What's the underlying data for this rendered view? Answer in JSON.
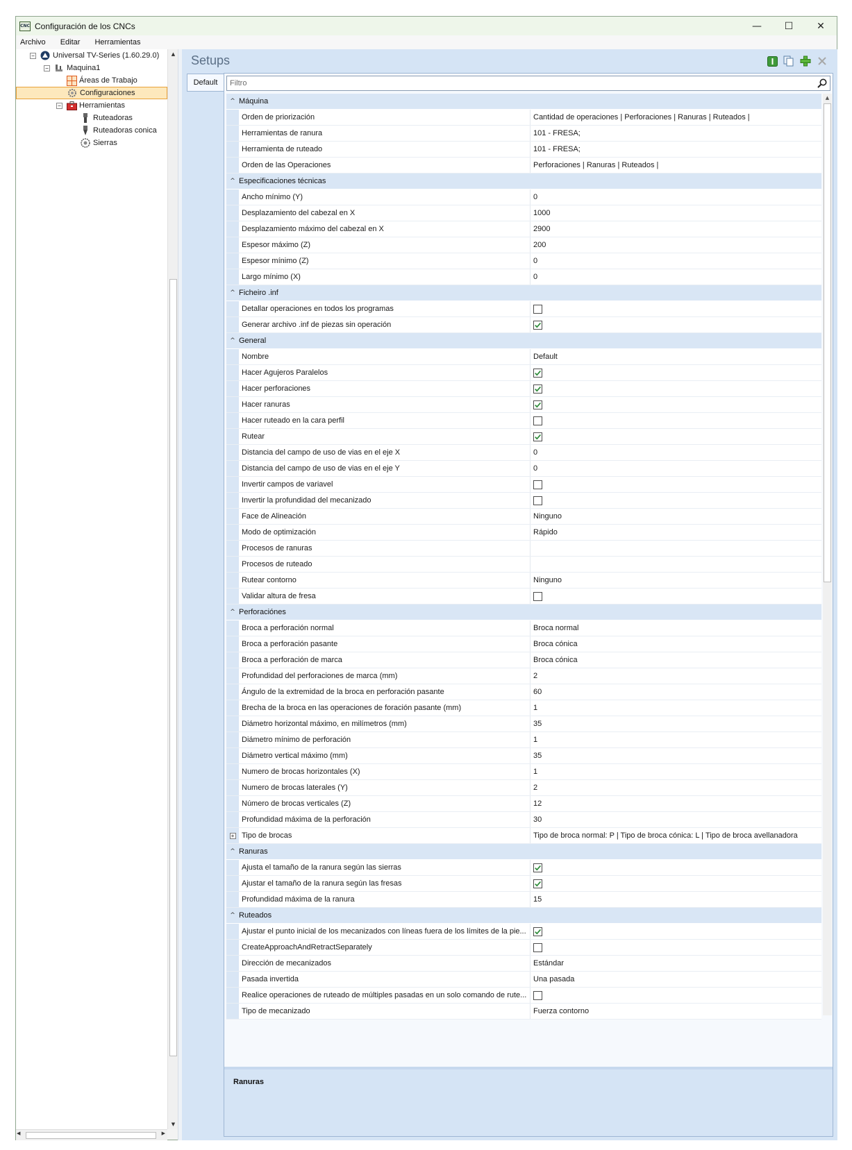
{
  "window": {
    "app_icon_text": "CNC",
    "title": "Configuración de los CNCs",
    "controls": {
      "minimize": "—",
      "maximize": "☐",
      "close": "✕"
    }
  },
  "menu": [
    "Archivo",
    "Editar",
    "Herramientas"
  ],
  "tree": {
    "root": "Universal TV-Series (1.60.29.0)",
    "machine": "Maquina1",
    "work_areas": "Áreas de Trabajo",
    "configs": "Configuraciones",
    "tools": "Herramientas",
    "routers": "Ruteadoras",
    "conic_routers": "Ruteadoras conica",
    "saws": "Sierras"
  },
  "panel": {
    "title": "Setups",
    "tab": "Default",
    "filter_placeholder": "Filtro",
    "description_title": "Ranuras"
  },
  "colors": {
    "accent": "#5b6f86",
    "category_bg": "#d9e6f5",
    "selected_bg": "#fde8bc",
    "check_green": "#2e8b3a"
  },
  "grid": {
    "categories": [
      {
        "label": "Máquina",
        "rows": [
          {
            "name": "Orden de priorización",
            "value": "Cantidad de operaciones | Perforaciones | Ranuras | Ruteados |"
          },
          {
            "name": "Herramientas de ranura",
            "value": "101 - FRESA;"
          },
          {
            "name": "Herramienta de ruteado",
            "value": "101 - FRESA;"
          },
          {
            "name": "Orden de las Operaciones",
            "value": "Perforaciones | Ranuras | Ruteados |"
          }
        ]
      },
      {
        "label": "Especificaciones técnicas",
        "rows": [
          {
            "name": "Ancho mínimo (Y)",
            "value": "0"
          },
          {
            "name": "Desplazamiento del cabezal en X",
            "value": "1000"
          },
          {
            "name": "Desplazamiento máximo del cabezal en X",
            "value": "2900"
          },
          {
            "name": "Espesor máximo (Z)",
            "value": "200"
          },
          {
            "name": "Espesor mínimo (Z)",
            "value": "0"
          },
          {
            "name": "Largo mínimo (X)",
            "value": "0"
          }
        ]
      },
      {
        "label": "Ficheiro .inf",
        "rows": [
          {
            "name": "Detallar operaciones en todos los programas",
            "check": false
          },
          {
            "name": "Generar archivo .inf de piezas sin operación",
            "check": true
          }
        ]
      },
      {
        "label": "General",
        "rows": [
          {
            "name": "Nombre",
            "value": "Default"
          },
          {
            "name": "Hacer Agujeros Paralelos",
            "check": true
          },
          {
            "name": "Hacer perforaciones",
            "check": true
          },
          {
            "name": "Hacer ranuras",
            "check": true
          },
          {
            "name": "Hacer ruteado en la cara perfil",
            "check": false
          },
          {
            "name": "Rutear",
            "check": true
          },
          {
            "name": "Distancia del campo de uso de vias en el eje X",
            "value": "0"
          },
          {
            "name": "Distancia del campo de uso de vias en el eje Y",
            "value": "0"
          },
          {
            "name": "Invertir campos de variavel",
            "check": false
          },
          {
            "name": "Invertir la profundidad del mecanizado",
            "check": false
          },
          {
            "name": "Face de Alineación",
            "value": "Ninguno"
          },
          {
            "name": "Modo de optimización",
            "value": "Rápido"
          },
          {
            "name": "Procesos de ranuras",
            "value": ""
          },
          {
            "name": "Procesos de ruteado",
            "value": ""
          },
          {
            "name": "Rutear contorno",
            "value": "Ninguno"
          },
          {
            "name": "Validar altura de fresa",
            "check": false
          }
        ]
      },
      {
        "label": "Perforaciónes",
        "rows": [
          {
            "name": "Broca a perforación normal",
            "value": "Broca normal"
          },
          {
            "name": "Broca a perforación pasante",
            "value": "Broca cónica"
          },
          {
            "name": "Broca a perforación de marca",
            "value": "Broca cónica"
          },
          {
            "name": "Profundidad del perforaciones de marca (mm)",
            "value": "2"
          },
          {
            "name": "Ángulo de la extremidad de la broca en perforación pasante",
            "value": "60"
          },
          {
            "name": "Brecha de la broca en las operaciones de foración pasante (mm)",
            "value": "1"
          },
          {
            "name": "Diámetro horizontal máximo, en milímetros (mm)",
            "value": "35"
          },
          {
            "name": "Diámetro mínimo de perforación",
            "value": "1"
          },
          {
            "name": "Diámetro vertical máximo (mm)",
            "value": "35"
          },
          {
            "name": "Numero de brocas horizontales (X)",
            "value": "1"
          },
          {
            "name": "Numero de brocas laterales (Y)",
            "value": "2"
          },
          {
            "name": "Número de brocas verticales (Z)",
            "value": "12"
          },
          {
            "name": "Profundidad máxima de la perforación",
            "value": "30"
          },
          {
            "name": "Tipo de brocas",
            "value": "Tipo de broca normal: P  |  Tipo de broca cónica: L  |  Tipo de broca avellanadora",
            "expandable": true
          }
        ]
      },
      {
        "label": "Ranuras",
        "rows": [
          {
            "name": "Ajusta el tamaño de la ranura según las sierras",
            "check": true
          },
          {
            "name": "Ajustar el tamaño de la ranura según las fresas",
            "check": true
          },
          {
            "name": "Profundidad máxima de la ranura",
            "value": "15"
          }
        ]
      },
      {
        "label": "Ruteados",
        "rows": [
          {
            "name": "Ajustar el punto inicial de los mecanizados con líneas fuera de los límites de la pie...",
            "check": true
          },
          {
            "name": "CreateApproachAndRetractSeparately",
            "check": false
          },
          {
            "name": "Dirección de mecanizados",
            "value": "Estándar"
          },
          {
            "name": "Pasada invertida",
            "value": "Una pasada"
          },
          {
            "name": "Realice operaciones de ruteado de múltiples pasadas en un solo comando de rute...",
            "check": false
          },
          {
            "name": "Tipo de mecanizado",
            "value": "Fuerza contorno"
          }
        ]
      }
    ]
  }
}
